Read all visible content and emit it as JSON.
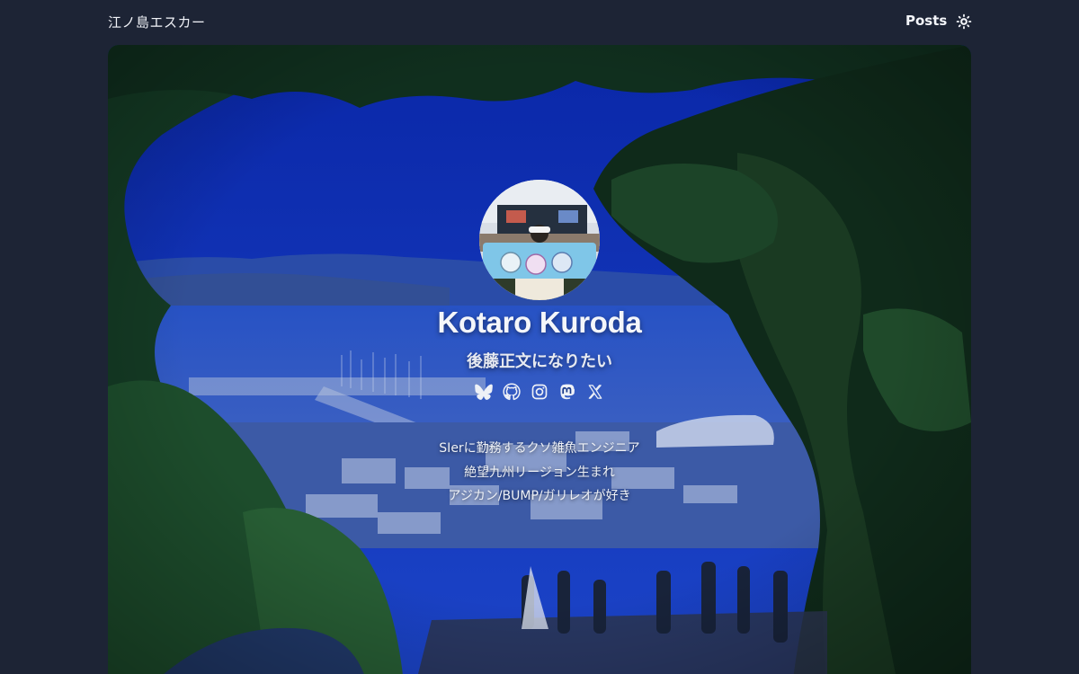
{
  "header": {
    "site_title": "江ノ島エスカー",
    "nav": {
      "posts_label": "Posts"
    },
    "theme_toggle_icon": "sun-gear-icon"
  },
  "profile": {
    "name": "Kotaro Kuroda",
    "tagline": "後藤正文になりたい",
    "bio_lines": [
      "SIerに勤務するクソ雑魚エンジニア",
      "絶望九州リージョン生まれ",
      "アジカン/BUMP/ガリレオが好き"
    ],
    "social_icons": [
      "bluesky-icon",
      "github-icon",
      "instagram-icon",
      "mastodon-icon",
      "x-icon"
    ]
  },
  "colors": {
    "page_background": "#1d2435",
    "hero_tint": "#0b2a8f",
    "text": "#f4f6fa"
  }
}
